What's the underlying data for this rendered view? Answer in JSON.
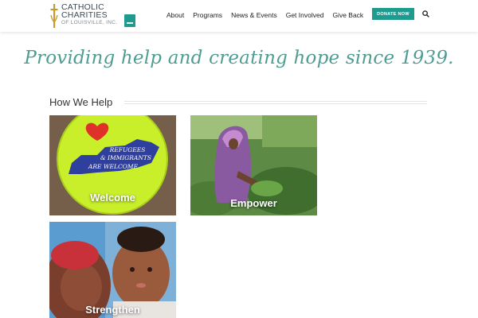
{
  "header": {
    "logo": {
      "line1": "CATHOLIC",
      "line2": "CHARITIES",
      "line3": "OF LOUISVILLE, INC."
    },
    "nav": [
      {
        "label": "About"
      },
      {
        "label": "Programs"
      },
      {
        "label": "News & Events"
      },
      {
        "label": "Get Involved"
      },
      {
        "label": "Give Back"
      }
    ],
    "donate_label": "DONATE NOW",
    "search_icon": "search-icon"
  },
  "tagline": "Providing help and creating hope since 1939.",
  "how_we_help": {
    "title": "How We Help",
    "tiles": [
      {
        "label": "Welcome",
        "button_text": [
          "REFUGEES",
          "& IMMIGRANTS",
          "ARE WELCOME"
        ]
      },
      {
        "label": "Empower"
      },
      {
        "label": "Strengthen"
      }
    ]
  },
  "colors": {
    "brand_teal": "#1f9a8f",
    "tagline": "#4e9c92"
  }
}
